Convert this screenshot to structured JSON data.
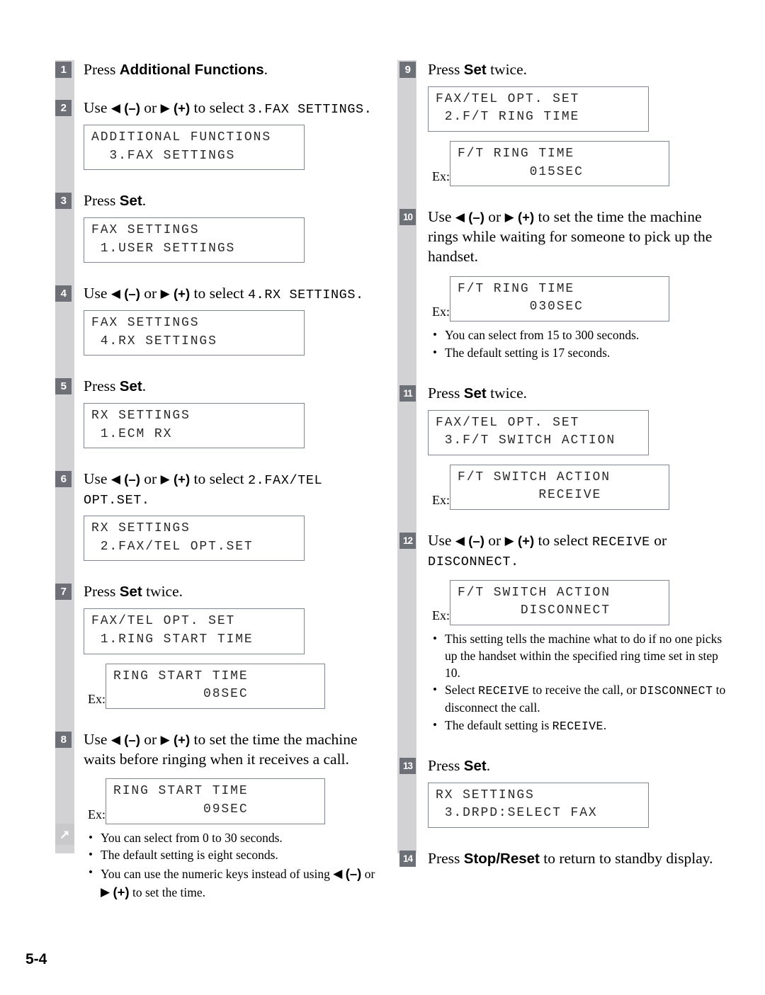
{
  "page": {
    "number": "5-4",
    "continue_marker_icon": "diagonal-arrow-up-right-icon"
  },
  "glyphs": {
    "left_triangle": "◀",
    "right_triangle": "▶",
    "minus": "(–)",
    "plus": "(+)",
    "bullet": "•"
  },
  "left_column": {
    "steps": [
      {
        "number": "1",
        "text_parts": [
          {
            "type": "plain",
            "text": "Press "
          },
          {
            "type": "bold",
            "text": "Additional Functions"
          },
          {
            "type": "plain",
            "text": "."
          }
        ],
        "plain_text": "Press Additional Functions."
      },
      {
        "number": "2",
        "plain_text": "Use ◀ (–) or ▶ (+) to select 3.FAX SETTINGS.",
        "select_code": "3.FAX SETTINGS.",
        "display": {
          "line1": "ADDITIONAL FUNCTIONS",
          "line2": "  3.FAX SETTINGS"
        }
      },
      {
        "number": "3",
        "plain_text": "Press Set.",
        "display": {
          "line1": "FAX SETTINGS",
          "line2": " 1.USER SETTINGS"
        }
      },
      {
        "number": "4",
        "plain_text": "Use ◀ (–) or ▶ (+) to select 4.RX SETTINGS.",
        "select_code": "4.RX SETTINGS.",
        "display": {
          "line1": "FAX SETTINGS",
          "line2": " 4.RX SETTINGS"
        }
      },
      {
        "number": "5",
        "plain_text": "Press Set.",
        "display": {
          "line1": "RX SETTINGS",
          "line2": " 1.ECM RX"
        }
      },
      {
        "number": "6",
        "plain_text": "Use ◀ (–) or ▶ (+) to select 2.FAX/TEL OPT.SET.",
        "select_code": "2.FAX/TEL OPT.SET.",
        "display": {
          "line1": "RX SETTINGS",
          "line2": " 2.FAX/TEL OPT.SET"
        }
      },
      {
        "number": "7",
        "plain_text": "Press Set twice.",
        "display": {
          "line1": "FAX/TEL OPT. SET",
          "line2": " 1.RING START TIME"
        },
        "example": {
          "label": "Ex:",
          "line1": "RING START TIME",
          "line2": "          08SEC"
        }
      },
      {
        "number": "8",
        "plain_text": "Use ◀ (–) or ▶ (+) to set the time the machine waits before ringing when it receives a call.",
        "example": {
          "label": "Ex:",
          "line1": "RING START TIME",
          "line2": "          09SEC"
        },
        "notes": [
          "You can select from 0 to 30 seconds.",
          "The default setting is eight seconds.",
          "You can use the numeric keys instead of using ◀ (–) or ▶ (+) to set the time."
        ]
      }
    ]
  },
  "right_column": {
    "steps": [
      {
        "number": "9",
        "plain_text": "Press Set twice.",
        "display": {
          "line1": "FAX/TEL OPT. SET",
          "line2": " 2.F/T RING TIME"
        },
        "example": {
          "label": "Ex:",
          "line1": "F/T RING TIME",
          "line2": "        015SEC"
        }
      },
      {
        "number": "10",
        "plain_text": "Use ◀ (–) or ▶ (+) to set the time the machine rings while waiting for someone to pick up the handset.",
        "example": {
          "label": "Ex:",
          "line1": "F/T RING TIME",
          "line2": "        030SEC"
        },
        "notes": [
          "You can select from 15 to 300 seconds.",
          "The default setting is 17 seconds."
        ]
      },
      {
        "number": "11",
        "plain_text": "Press Set twice.",
        "display": {
          "line1": "FAX/TEL OPT. SET",
          "line2": " 3.F/T SWITCH ACTION"
        },
        "example": {
          "label": "Ex:",
          "line1": "F/T SWITCH ACTION",
          "line2": "         RECEIVE"
        }
      },
      {
        "number": "12",
        "plain_text": "Use ◀ (–) or ▶ (+) to select RECEIVE or DISCONNECT.",
        "option_a": "RECEIVE",
        "option_b": "DISCONNECT.",
        "example": {
          "label": "Ex:",
          "line1": "F/T SWITCH ACTION",
          "line2": "       DISCONNECT"
        },
        "notes": [
          "This setting tells the machine what to do if no one picks up the handset within the specified ring time set in step 10.",
          "Select RECEIVE to receive the call, or DISCONNECT to disconnect the call.",
          "The default setting is RECEIVE."
        ]
      },
      {
        "number": "13",
        "plain_text": "Press Set.",
        "display": {
          "line1": "RX SETTINGS",
          "line2": " 3.DRPD:SELECT FAX"
        }
      },
      {
        "number": "14",
        "plain_text": "Press Stop/Reset to return to standby display."
      }
    ]
  },
  "labels": {
    "press": "Press",
    "use": "Use",
    "or": "or",
    "to_select": "to select",
    "twice": "twice.",
    "set": "Set",
    "additional_functions": "Additional Functions",
    "stop_reset": "Stop/Reset",
    "ex": "Ex:"
  }
}
